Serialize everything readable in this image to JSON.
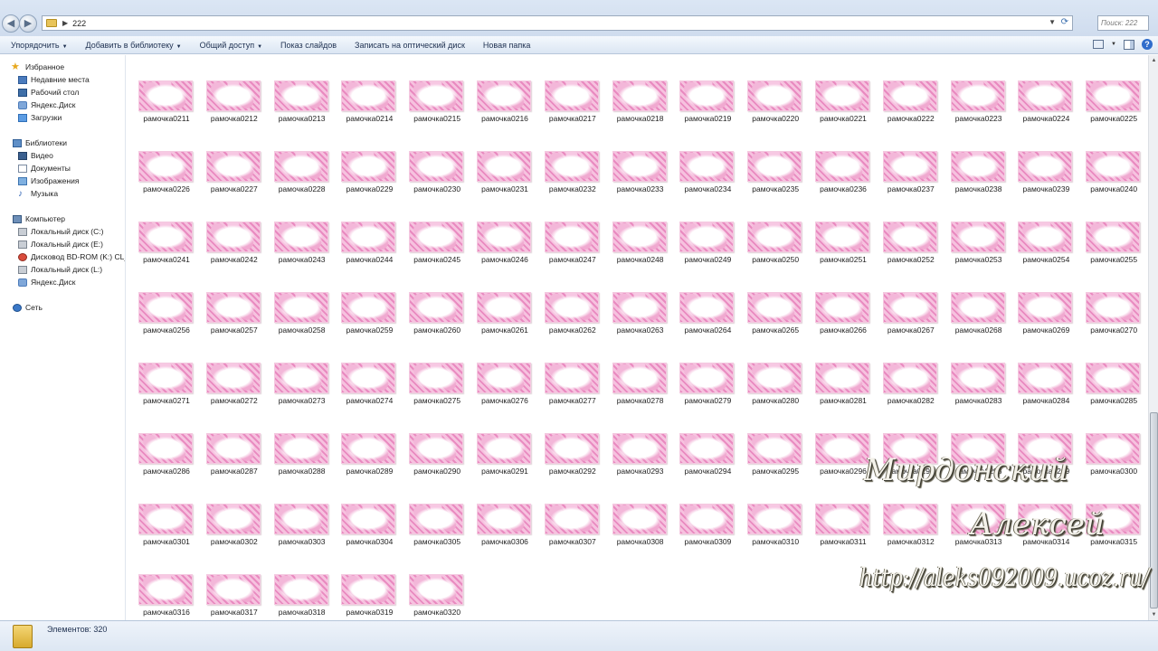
{
  "address": {
    "path": "222",
    "search_placeholder": "Поиск: 222"
  },
  "toolbar": {
    "organize": "Упорядочить",
    "add_to_library": "Добавить в библиотеку",
    "share": "Общий доступ",
    "slideshow": "Показ слайдов",
    "burn": "Записать на оптический диск",
    "new_folder": "Новая папка"
  },
  "nav": {
    "favorites": "Избранное",
    "fav_items": [
      "Недавние места",
      "Рабочий стол",
      "Яндекс.Диск",
      "Загрузки"
    ],
    "libraries": "Библиотеки",
    "lib_items": [
      "Видео",
      "Документы",
      "Изображения",
      "Музыка"
    ],
    "computer": "Компьютер",
    "comp_items": [
      "Локальный диск (C:)",
      "Локальный диск (E:)",
      "Дисковод BD-ROM (K:) CL_RI",
      "Локальный диск (L:)",
      "Яндекс.Диск"
    ],
    "network": "Сеть"
  },
  "files": [
    "рамочка0211",
    "рамочка0212",
    "рамочка0213",
    "рамочка0214",
    "рамочка0215",
    "рамочка0216",
    "рамочка0217",
    "рамочка0218",
    "рамочка0219",
    "рамочка0220",
    "рамочка0221",
    "рамочка0222",
    "рамочка0223",
    "рамочка0224",
    "рамочка0225",
    "рамочка0226",
    "рамочка0227",
    "рамочка0228",
    "рамочка0229",
    "рамочка0230",
    "рамочка0231",
    "рамочка0232",
    "рамочка0233",
    "рамочка0234",
    "рамочка0235",
    "рамочка0236",
    "рамочка0237",
    "рамочка0238",
    "рамочка0239",
    "рамочка0240",
    "рамочка0241",
    "рамочка0242",
    "рамочка0243",
    "рамочка0244",
    "рамочка0245",
    "рамочка0246",
    "рамочка0247",
    "рамочка0248",
    "рамочка0249",
    "рамочка0250",
    "рамочка0251",
    "рамочка0252",
    "рамочка0253",
    "рамочка0254",
    "рамочка0255",
    "рамочка0256",
    "рамочка0257",
    "рамочка0258",
    "рамочка0259",
    "рамочка0260",
    "рамочка0261",
    "рамочка0262",
    "рамочка0263",
    "рамочка0264",
    "рамочка0265",
    "рамочка0266",
    "рамочка0267",
    "рамочка0268",
    "рамочка0269",
    "рамочка0270",
    "рамочка0271",
    "рамочка0272",
    "рамочка0273",
    "рамочка0274",
    "рамочка0275",
    "рамочка0276",
    "рамочка0277",
    "рамочка0278",
    "рамочка0279",
    "рамочка0280",
    "рамочка0281",
    "рамочка0282",
    "рамочка0283",
    "рамочка0284",
    "рамочка0285",
    "рамочка0286",
    "рамочка0287",
    "рамочка0288",
    "рамочка0289",
    "рамочка0290",
    "рамочка0291",
    "рамочка0292",
    "рамочка0293",
    "рамочка0294",
    "рамочка0295",
    "рамочка0296",
    "рамочка0297",
    "рамочка0298",
    "рамочка0299",
    "рамочка0300",
    "рамочка0301",
    "рамочка0302",
    "рамочка0303",
    "рамочка0304",
    "рамочка0305",
    "рамочка0306",
    "рамочка0307",
    "рамочка0308",
    "рамочка0309",
    "рамочка0310",
    "рамочка0311",
    "рамочка0312",
    "рамочка0313",
    "рамочка0314",
    "рамочка0315",
    "рамочка0316",
    "рамочка0317",
    "рамочка0318",
    "рамочка0319",
    "рамочка0320"
  ],
  "status": {
    "count_text": "Элементов: 320"
  },
  "watermark": {
    "line1": "Мирдонский",
    "line2": "Алексей",
    "url": "http://aleks092009.ucoz.ru/"
  }
}
